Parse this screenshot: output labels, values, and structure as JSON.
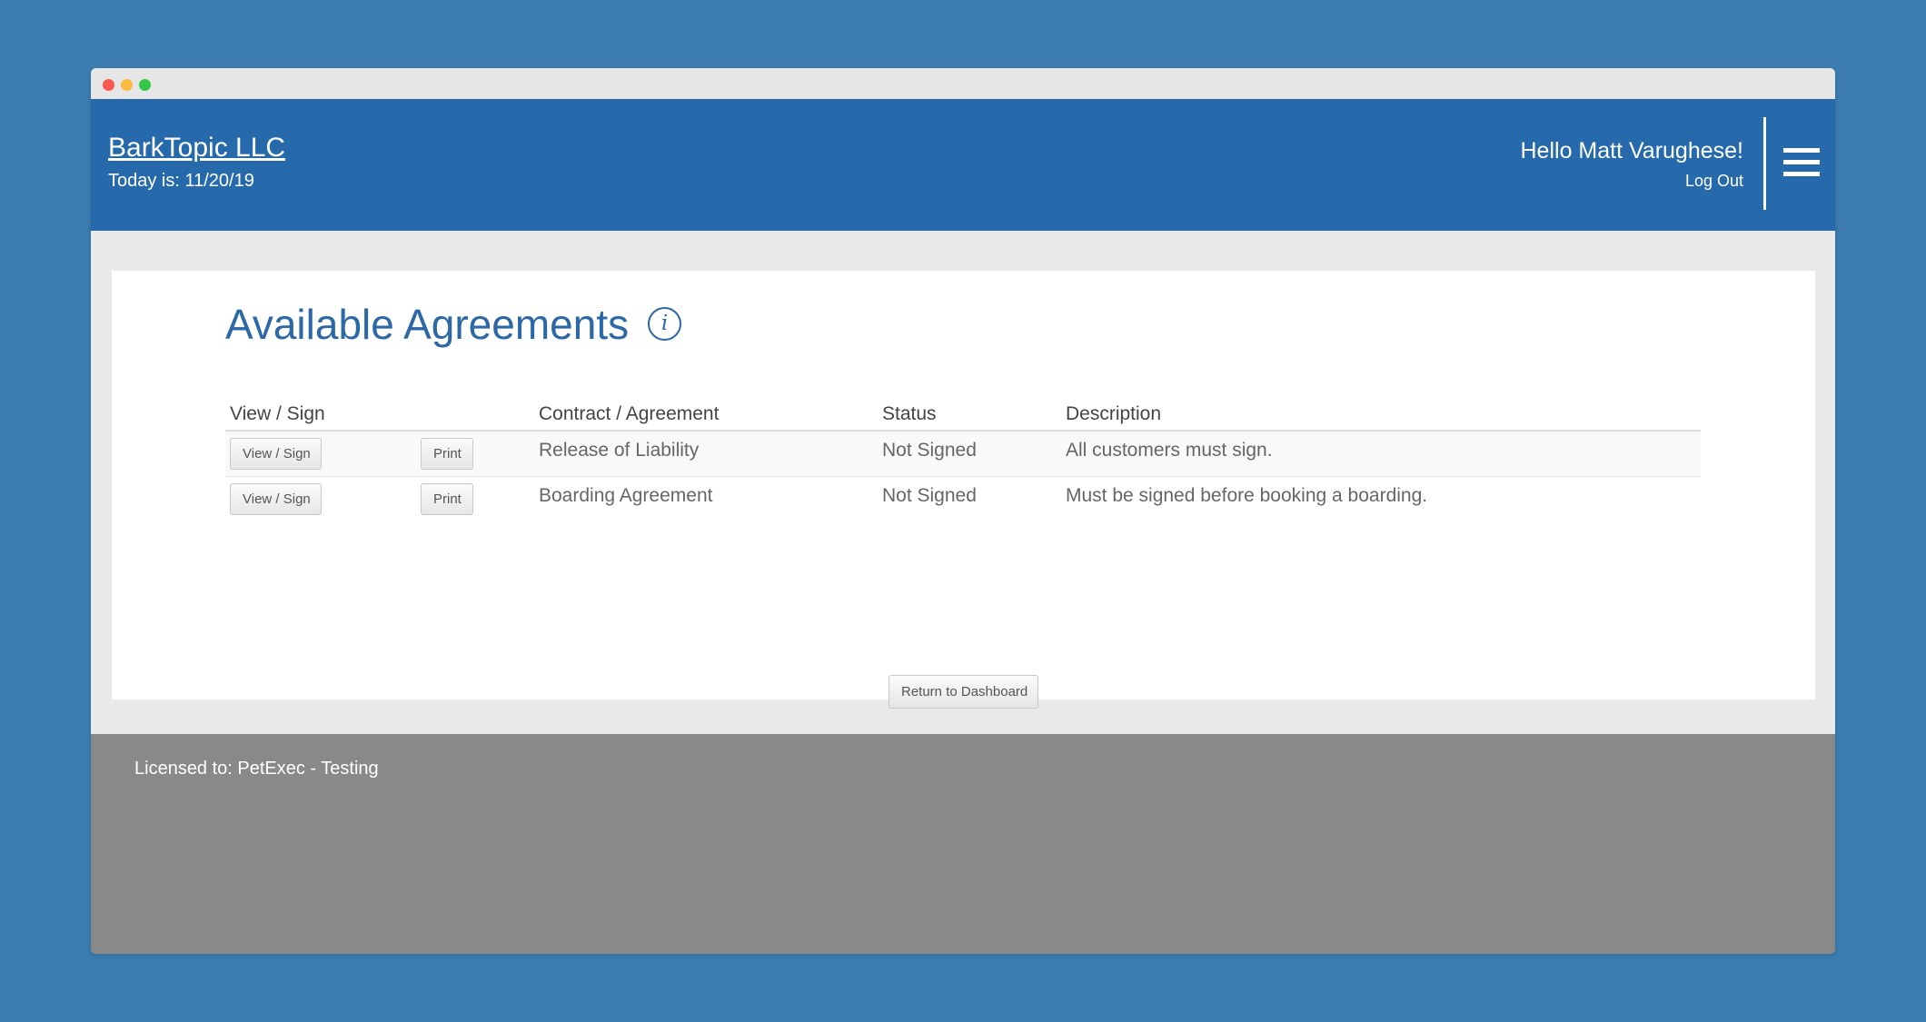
{
  "header": {
    "brand": "BarkTopic LLC",
    "today": "Today is: 11/20/19",
    "greeting": "Hello Matt Varughese!",
    "logout": "Log Out",
    "menu_icon": "hamburger-menu-icon"
  },
  "main": {
    "title": "Available Agreements",
    "info_icon": "i",
    "table": {
      "headers": {
        "view_sign": "View / Sign",
        "contract": "Contract / Agreement",
        "status": "Status",
        "description": "Description"
      },
      "rows": [
        {
          "view_label": "View / Sign",
          "print_label": "Print",
          "contract": "Release of Liability",
          "status": "Not Signed",
          "description": "All customers must sign."
        },
        {
          "view_label": "View / Sign",
          "print_label": "Print",
          "contract": "Boarding Agreement",
          "status": "Not Signed",
          "description": "Must be signed before booking a boarding."
        }
      ]
    },
    "return_label": "Return to Dashboard"
  },
  "footer": {
    "licensed": "Licensed to: PetExec - Testing"
  },
  "colors": {
    "background": "#3d7db2",
    "header": "#276aab",
    "title": "#2c67a6",
    "footer": "#898989"
  }
}
